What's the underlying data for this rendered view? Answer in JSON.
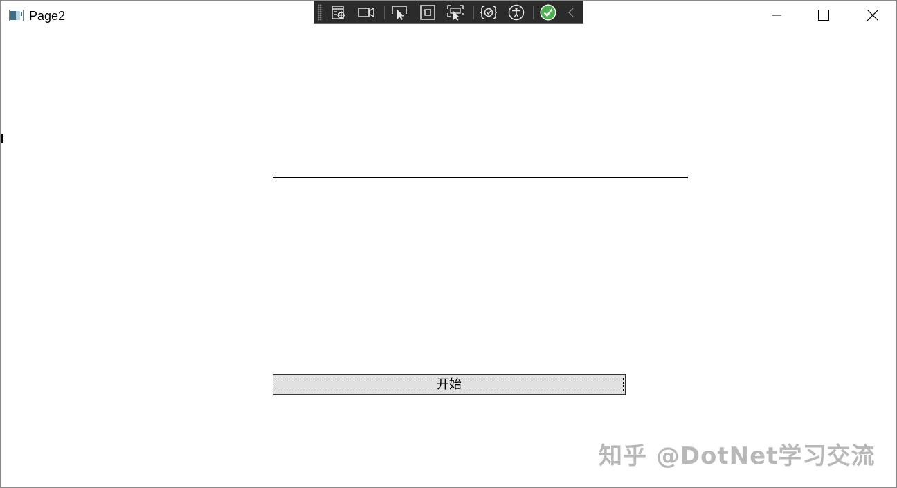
{
  "window": {
    "title": "Page2"
  },
  "debug_toolbar": {
    "buttons": [
      {
        "name": "live-visual-tree-icon"
      },
      {
        "name": "video-camera-icon"
      },
      {
        "name": "select-element-icon"
      },
      {
        "name": "display-layout-adorners-icon"
      },
      {
        "name": "track-focused-element-icon"
      },
      {
        "name": "binding-failures-icon"
      },
      {
        "name": "accessibility-icon"
      },
      {
        "name": "checkmark-icon"
      },
      {
        "name": "collapse-chevron-icon"
      }
    ],
    "accent_color": "#4caf50"
  },
  "main": {
    "start_button_label": "开始"
  },
  "watermark": {
    "text": "知乎 @DotNet学习交流"
  }
}
